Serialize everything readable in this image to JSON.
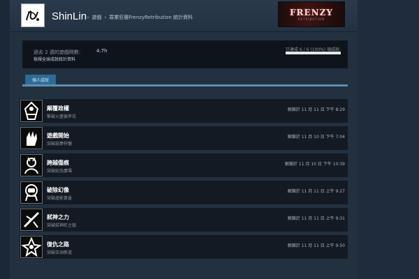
{
  "header": {
    "username": "ShinLin",
    "breadcrumb": {
      "separator": "»",
      "games": "遊戲",
      "game_stats": "罪業狂襲FrenzyRetribution 統計資料"
    },
    "banner": {
      "title": "FRENZY",
      "subtitle": "RETRIBUTION"
    }
  },
  "stats": {
    "playtime_label": "過去 2 週的遊戲時數:",
    "playtime_value": "4.7h",
    "global_stats_link": "檢視全球成就統計資料",
    "progress_text": "已達成 6 / 6 (100%) 項成就:",
    "progress_fraction": 1.0
  },
  "tabs": [
    {
      "label": "個人成就",
      "active": true
    }
  ],
  "achievements": [
    {
      "title": "顛覆政權",
      "description": "擊破火盛彼岸花",
      "unlock": "解鎖於 11 月 11 日 下午 8:29",
      "icon": "mask-figure-icon"
    },
    {
      "title": "遊戲開始",
      "description": "突破惡夢狩獵",
      "unlock": "解鎖於 11 月 10 日 下午 7:04",
      "icon": "hand-icon"
    },
    {
      "title": "跨越傷痕",
      "description": "突破紀念廣場",
      "unlock": "解鎖於 11 月 10 日 下午 10:39",
      "icon": "warrior-icon"
    },
    {
      "title": "破除幻像",
      "description": "突破虛影黃昏",
      "unlock": "解鎖於 11 月 11 日 上午 9:27",
      "icon": "astronaut-icon"
    },
    {
      "title": "弒神之力",
      "description": "突破弒神町之嶽",
      "unlock": "解鎖於 11 月 11 日 上午 9:31",
      "icon": "slash-icon"
    },
    {
      "title": "復仇之路",
      "description": "突破亞洲新道",
      "unlock": "解鎖於 11 月 11 日 上午 9:50",
      "icon": "warrior-crest-icon"
    }
  ]
}
